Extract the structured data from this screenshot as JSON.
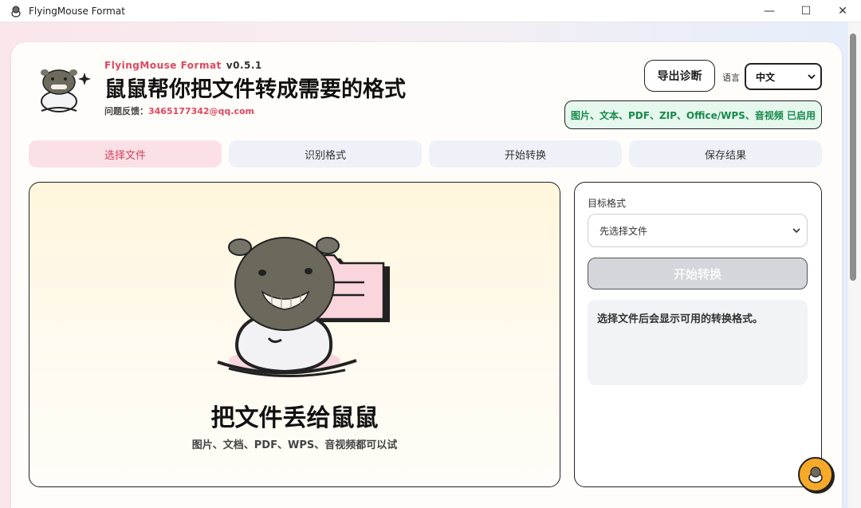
{
  "window": {
    "title": "FlyingMouse Format",
    "controls": {
      "minimize": "—",
      "maximize": "☐",
      "close": "✕"
    }
  },
  "header": {
    "brand": "FlyingMouse Format",
    "version": "v0.5.1",
    "headline": "鼠鼠帮你把文件转成需要的格式",
    "feedback_label": "问题反馈：",
    "feedback_email": "3465177342@qq.com",
    "export_button": "导出诊断",
    "language_label": "语言",
    "language_value": "中文",
    "enabled_badge": "图片、文本、PDF、ZIP、Office/WPS、音视频 已启用"
  },
  "steps": [
    {
      "label": "选择文件",
      "active": true
    },
    {
      "label": "识别格式",
      "active": false
    },
    {
      "label": "开始转换",
      "active": false
    },
    {
      "label": "保存结果",
      "active": false
    }
  ],
  "dropzone": {
    "title": "把文件丢给鼠鼠",
    "subtitle": "图片、文档、PDF、WPS、音视频都可以试"
  },
  "panel": {
    "target_label": "目标格式",
    "select_value": "先选择文件",
    "start_button": "开始转换",
    "hint": "选择文件后会显示可用的转换格式。"
  },
  "colors": {
    "accent": "#e0475f",
    "badge_green": "#178a4a",
    "fab": "#f7a929"
  },
  "icons": {
    "app": "mouse-icon",
    "chevron": "chevron-down-icon",
    "folder": "folder-icon",
    "sparkle": "sparkle-icon"
  }
}
